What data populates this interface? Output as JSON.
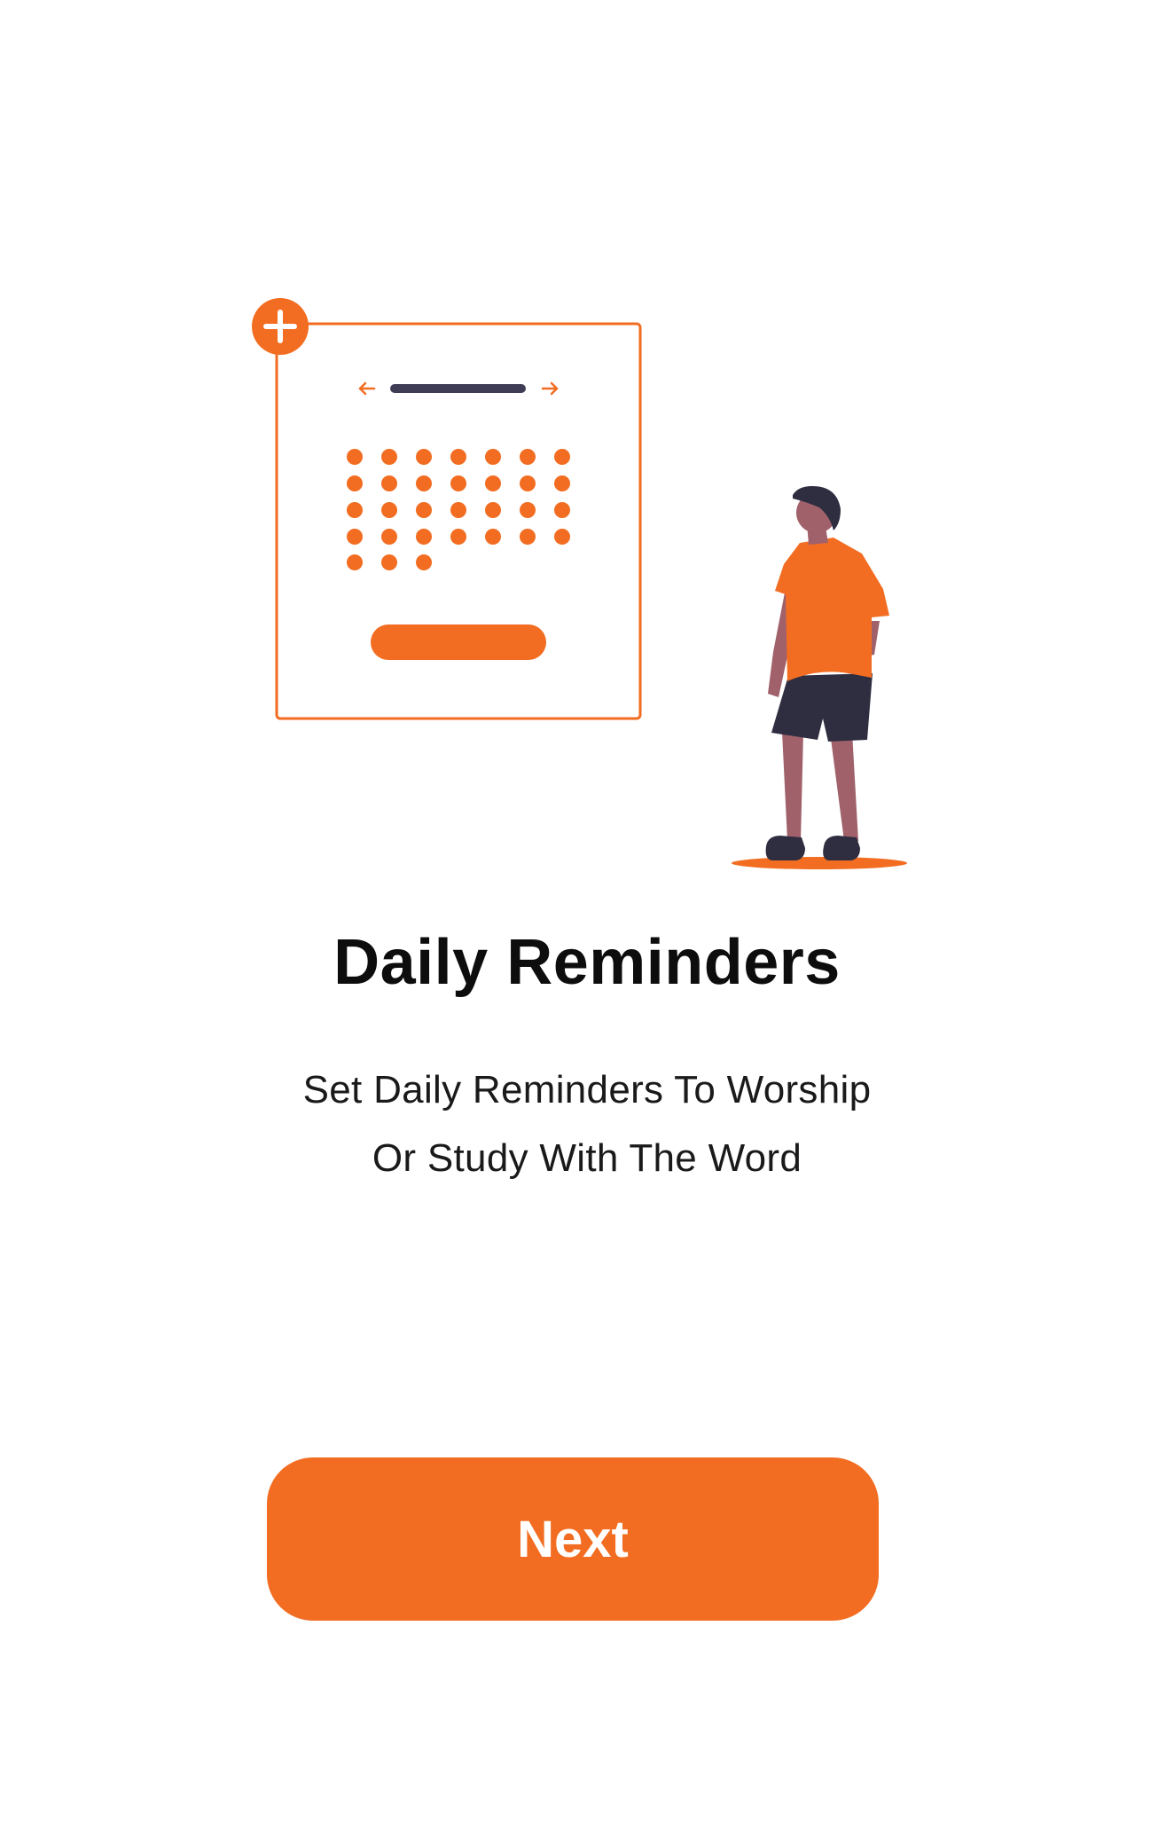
{
  "colors": {
    "accent": "#f26d21",
    "dark": "#3f3d56",
    "skin": "#a0616a",
    "background": "#ffffff"
  },
  "illustration": {
    "icons": [
      "plus-icon",
      "arrow-left-icon",
      "arrow-right-icon"
    ]
  },
  "onboarding": {
    "title": "Daily Reminders",
    "subtitle_line1": "Set Daily Reminders To Worship",
    "subtitle_line2": "Or Study With The Word"
  },
  "actions": {
    "next_label": "Next"
  }
}
